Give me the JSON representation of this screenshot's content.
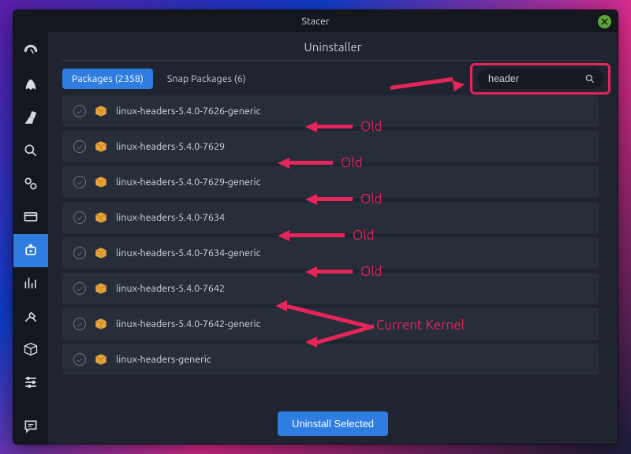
{
  "window": {
    "title": "Stacer"
  },
  "page": {
    "title": "Uninstaller"
  },
  "tabs": {
    "packages": "Packages (2358)",
    "snap": "Snap Packages (6)"
  },
  "search": {
    "value": "header"
  },
  "packages": [
    {
      "name": "linux-headers-5.4.0-7626-generic"
    },
    {
      "name": "linux-headers-5.4.0-7629"
    },
    {
      "name": "linux-headers-5.4.0-7629-generic"
    },
    {
      "name": "linux-headers-5.4.0-7634"
    },
    {
      "name": "linux-headers-5.4.0-7634-generic"
    },
    {
      "name": "linux-headers-5.4.0-7642"
    },
    {
      "name": "linux-headers-5.4.0-7642-generic"
    },
    {
      "name": "linux-headers-generic"
    }
  ],
  "footer": {
    "button": "Uninstall Selected"
  },
  "annotations": {
    "old": "Old",
    "current": "Current Kernel"
  }
}
